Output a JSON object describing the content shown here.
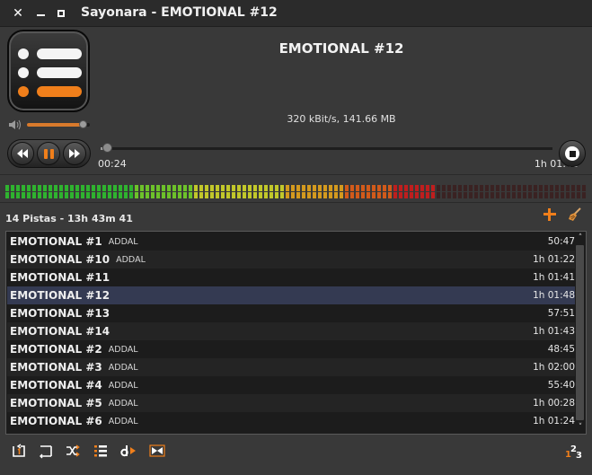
{
  "window": {
    "title": "Sayonara - EMOTIONAL #12"
  },
  "now_playing": {
    "title": "EMOTIONAL #12",
    "info": "320 kBit/s, 141.66 MB",
    "elapsed": "00:24",
    "total": "1h 01:48",
    "progress": 0.0065,
    "volume": 0.9
  },
  "playlist": {
    "summary": "14 Pistas - 13h 43m 41",
    "active_index": 3,
    "rows": [
      {
        "title": "EMOTIONAL #1",
        "artist": "ADDAL",
        "duration": "50:47"
      },
      {
        "title": "EMOTIONAL #10",
        "artist": "ADDAL",
        "duration": "1h 01:22"
      },
      {
        "title": "EMOTIONAL #11",
        "artist": "",
        "duration": "1h 01:41"
      },
      {
        "title": "EMOTIONAL #12",
        "artist": "",
        "duration": "1h 01:48"
      },
      {
        "title": "EMOTIONAL #13",
        "artist": "",
        "duration": "57:51"
      },
      {
        "title": "EMOTIONAL #14",
        "artist": "",
        "duration": "1h 01:43"
      },
      {
        "title": "EMOTIONAL #2",
        "artist": "ADDAL",
        "duration": "48:45"
      },
      {
        "title": "EMOTIONAL #3",
        "artist": "ADDAL",
        "duration": "1h 02:00"
      },
      {
        "title": "EMOTIONAL #4",
        "artist": "ADDAL",
        "duration": "55:40"
      },
      {
        "title": "EMOTIONAL #5",
        "artist": "ADDAL",
        "duration": "1h 00:28"
      },
      {
        "title": "EMOTIONAL #6",
        "artist": "ADDAL",
        "duration": "1h 01:24"
      }
    ]
  },
  "level_meter": {
    "level": 0.74
  },
  "colors": {
    "accent": "#f07f1b",
    "active_row": "#343a52"
  },
  "icons": {
    "toolbar": [
      "repeat-one-icon",
      "repeat-all-icon",
      "shuffle-icon",
      "append-icon",
      "dynamic-icon",
      "gapless-icon"
    ],
    "numbering": "track-numbers-icon"
  }
}
